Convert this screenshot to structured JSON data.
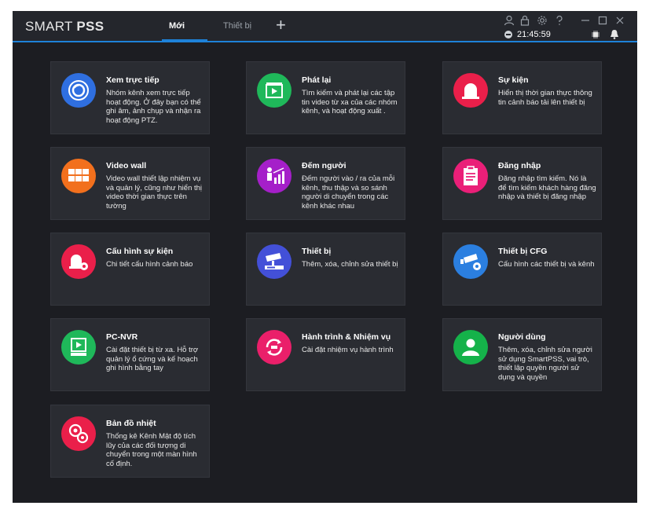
{
  "app": {
    "brand_light": "SMART ",
    "brand_bold": "PSS",
    "tabs": [
      {
        "label": "Mới",
        "active": true
      },
      {
        "label": "Thiết bị",
        "active": false
      }
    ],
    "add_tab": "+",
    "time": "21:45:59"
  },
  "colors": {
    "accent": "#1e82d9",
    "card_bg": "#2a2c32",
    "window_bg": "#1c1d22"
  },
  "cards": [
    {
      "title": "Xem trực tiếp",
      "desc": "Nhóm kênh xem trực tiếp hoạt động. Ở đây bạn có thể ghi âm, ảnh chụp và nhận ra hoạt động PTZ.",
      "icon": "live-view-icon",
      "color": "#2f6fe0"
    },
    {
      "title": "Phát lại",
      "desc": "Tìm kiếm và phát lại các tập tin video từ xa của các nhóm kênh, và hoạt động xuất .",
      "icon": "playback-icon",
      "color": "#1fb85a"
    },
    {
      "title": "Sự kiện",
      "desc": "Hiển thị thời gian thực thông tin cảnh báo tải lên thiết bị",
      "icon": "alarm-icon",
      "color": "#ea1f4a"
    },
    {
      "title": "Video wall",
      "desc": "Video wall thiết lập nhiệm vụ và quản lý, cũng như hiển thị video thời gian thực trên tường",
      "icon": "video-wall-icon",
      "color": "#f2701d"
    },
    {
      "title": "Đếm người",
      "desc": "Đếm người vào / ra của mỗi kênh, thu thập và so sánh người di chuyển trong các kênh khác nhau",
      "icon": "people-count-icon",
      "color": "#a51fc9"
    },
    {
      "title": "Đăng nhập",
      "desc": "Đăng nhập tìm kiếm. Nó là để tìm kiếm khách hàng đăng nhập và thiết bị đăng nhập",
      "icon": "clipboard-icon",
      "color": "#ea1f78"
    },
    {
      "title": "Cấu hình sự kiện",
      "desc": "Chi tiết cấu hình cảnh báo",
      "icon": "event-config-icon",
      "color": "#ea1f4a"
    },
    {
      "title": "Thiết bị",
      "desc": "Thêm, xóa, chỉnh sửa thiết bị",
      "icon": "device-icon",
      "color": "#4350d8"
    },
    {
      "title": "Thiết bị CFG",
      "desc": "Cấu hình các thiết bị và kênh",
      "icon": "device-cfg-icon",
      "color": "#2b7fe0"
    },
    {
      "title": "PC-NVR",
      "desc": "Cài đặt thiết bị từ xa. Hỗ trợ quản lý ổ cứng và kế hoạch ghi hình bằng tay",
      "icon": "pc-nvr-icon",
      "color": "#1fb85a"
    },
    {
      "title": "Hành trình & Nhiệm vụ",
      "desc": "Cài đặt nhiệm vụ hành trình",
      "icon": "tour-task-icon",
      "color": "#ea1f6a"
    },
    {
      "title": "Người dùng",
      "desc": "Thêm, xóa, chỉnh sửa người sử dụng SmartPSS, vai trò, thiết lập quyền người sử dụng và quyền",
      "icon": "user-icon",
      "color": "#15b24a"
    },
    {
      "title": "Bản đồ nhiệt",
      "desc": "Thống kê Kênh Mật độ tích lũy của các đối tượng di chuyển trong một màn hình cố định.",
      "icon": "heatmap-icon",
      "color": "#ea1f4a"
    }
  ]
}
